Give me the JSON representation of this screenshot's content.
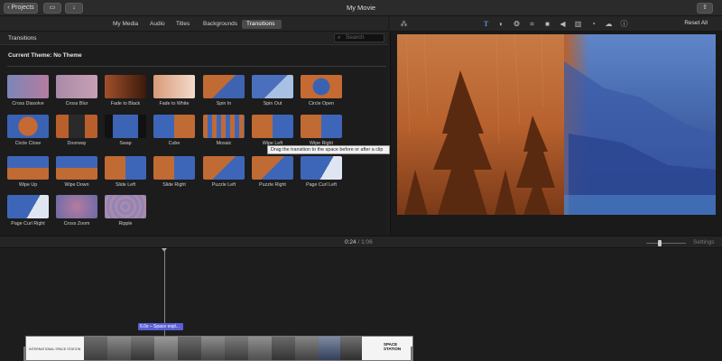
{
  "window": {
    "title": "My Movie",
    "projects_button": "Projects",
    "projects_chevron": "‹"
  },
  "media_tabs": [
    {
      "label": "My Media"
    },
    {
      "label": "Audio"
    },
    {
      "label": "Titles"
    },
    {
      "label": "Backgrounds"
    },
    {
      "label": "Transitions",
      "active": true
    }
  ],
  "viewer_toolbar": {
    "icons": [
      "magic-wand-icon",
      "title-text-icon",
      "color-balance-icon",
      "color-palette-icon",
      "crop-icon",
      "camera-stabilization-icon",
      "volume-icon",
      "equalizer-icon",
      "speed-icon",
      "noise-reduction-icon",
      "info-icon"
    ],
    "reset_all": "Reset All"
  },
  "browser": {
    "title": "Transitions",
    "search_placeholder": "Search",
    "current_theme": "Current Theme: No Theme",
    "tiles": [
      {
        "label": "Cross Dissolve",
        "style": "dissolve"
      },
      {
        "label": "Cross Blur",
        "style": "blur"
      },
      {
        "label": "Fade to Black",
        "style": "black"
      },
      {
        "label": "Fade to White",
        "style": "white"
      },
      {
        "label": "Spin In",
        "style": "spin"
      },
      {
        "label": "Spin Out",
        "style": "spinout"
      },
      {
        "label": "Circle Open",
        "style": "circle"
      },
      {
        "label": "Circle Close",
        "style": "circleclose"
      },
      {
        "label": "Doorway",
        "style": "door"
      },
      {
        "label": "Swap",
        "style": "swap"
      },
      {
        "label": "Cube",
        "style": "cube"
      },
      {
        "label": "Mosaic",
        "style": "mosaic"
      },
      {
        "label": "Wipe Left",
        "style": "wipe"
      },
      {
        "label": "Wipe Right",
        "style": "wipe"
      },
      {
        "label": "Wipe Up",
        "style": "wipeup"
      },
      {
        "label": "Wipe Down",
        "style": "wipeup"
      },
      {
        "label": "Slide Left",
        "style": "wipe"
      },
      {
        "label": "Slide Right",
        "style": "wipe"
      },
      {
        "label": "Puzzle Left",
        "style": "puzzle"
      },
      {
        "label": "Puzzle Right",
        "style": "puzzle"
      },
      {
        "label": "Page Curl Left",
        "style": "curl"
      },
      {
        "label": "Page Curl Right",
        "style": "curl"
      },
      {
        "label": "Cross Zoom",
        "style": "zoom"
      },
      {
        "label": "Ripple",
        "style": "ripple"
      }
    ],
    "tooltip": "Drag the transition to the space before or after a clip"
  },
  "timeline": {
    "current_time": "0:24",
    "separator": "/",
    "total_time": "1:06",
    "settings_label": "Settings",
    "clip_tag": "6.0s – Space expl...",
    "left_title_card": "INTERNATIONAL SPACE STATION",
    "right_title_card": "SPACE STATION"
  },
  "colors": {
    "accent": "#5a5fd6",
    "warm": "#c8703a",
    "cool": "#4a6fb8"
  }
}
